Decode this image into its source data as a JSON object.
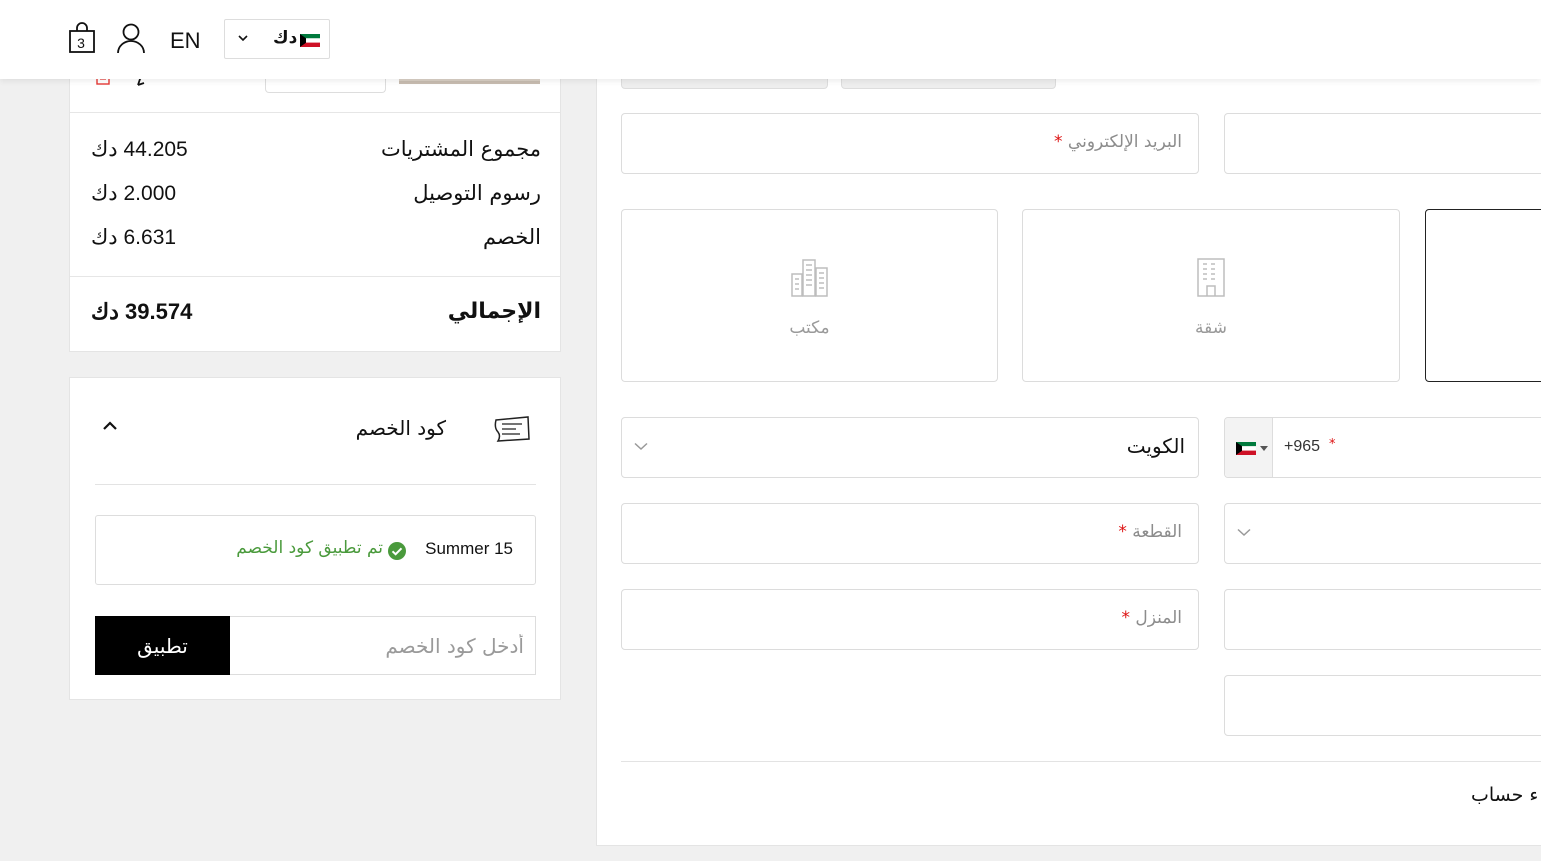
{
  "header": {
    "cart_count": "3",
    "language": "EN",
    "currency": {
      "label": "دك",
      "flag": "kuwait-flag"
    }
  },
  "summary": {
    "rows": [
      {
        "label": "مجموع المشتريات",
        "value": "44.205 دك"
      },
      {
        "label": "رسوم التوصيل",
        "value": "2.000 دك"
      },
      {
        "label": "الخصم",
        "value": "6.631 دك"
      }
    ],
    "total": {
      "label": "الإجمالي",
      "value": "39.574 دك"
    }
  },
  "discount": {
    "title": "كود الخصم",
    "applied_code": "Summer 15",
    "applied_message": "تم تطبيق كود الخصم",
    "input_placeholder": "أدخل كود الخصم",
    "apply_label": "تطبيق",
    "success_color": "#4a9a3c"
  },
  "form": {
    "email_placeholder": "البريد الإلكتروني",
    "address_types": [
      {
        "label": "مكتب",
        "icon": "office-building-icon"
      },
      {
        "label": "شقة",
        "icon": "apartment-building-icon"
      }
    ],
    "country_value": "الكويت",
    "phone_code": "+965",
    "block_placeholder": "القطعة",
    "house_placeholder": "المنزل",
    "required_mark": "*",
    "create_account_text": "ء حساب"
  }
}
